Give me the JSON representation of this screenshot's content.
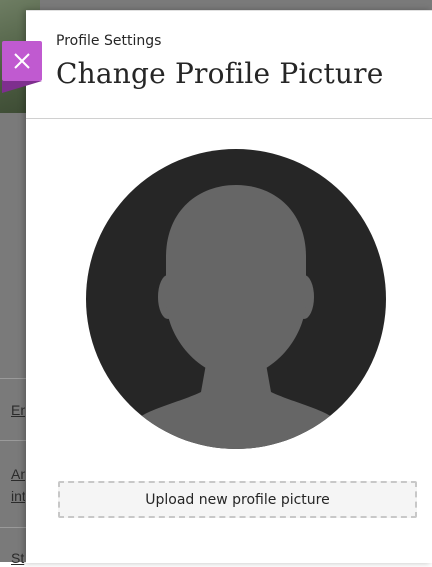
{
  "background": {
    "links": [
      "En",
      "An",
      "int",
      "St"
    ]
  },
  "panel": {
    "eyebrow": "Profile Settings",
    "title": "Change Profile Picture",
    "upload_label": "Upload new profile picture"
  },
  "colors": {
    "close_button": "#c05ad0",
    "avatar_background": "#262626",
    "avatar_silhouette": "#666666"
  },
  "icons": {
    "close": "close-icon",
    "avatar": "default-avatar-icon"
  }
}
